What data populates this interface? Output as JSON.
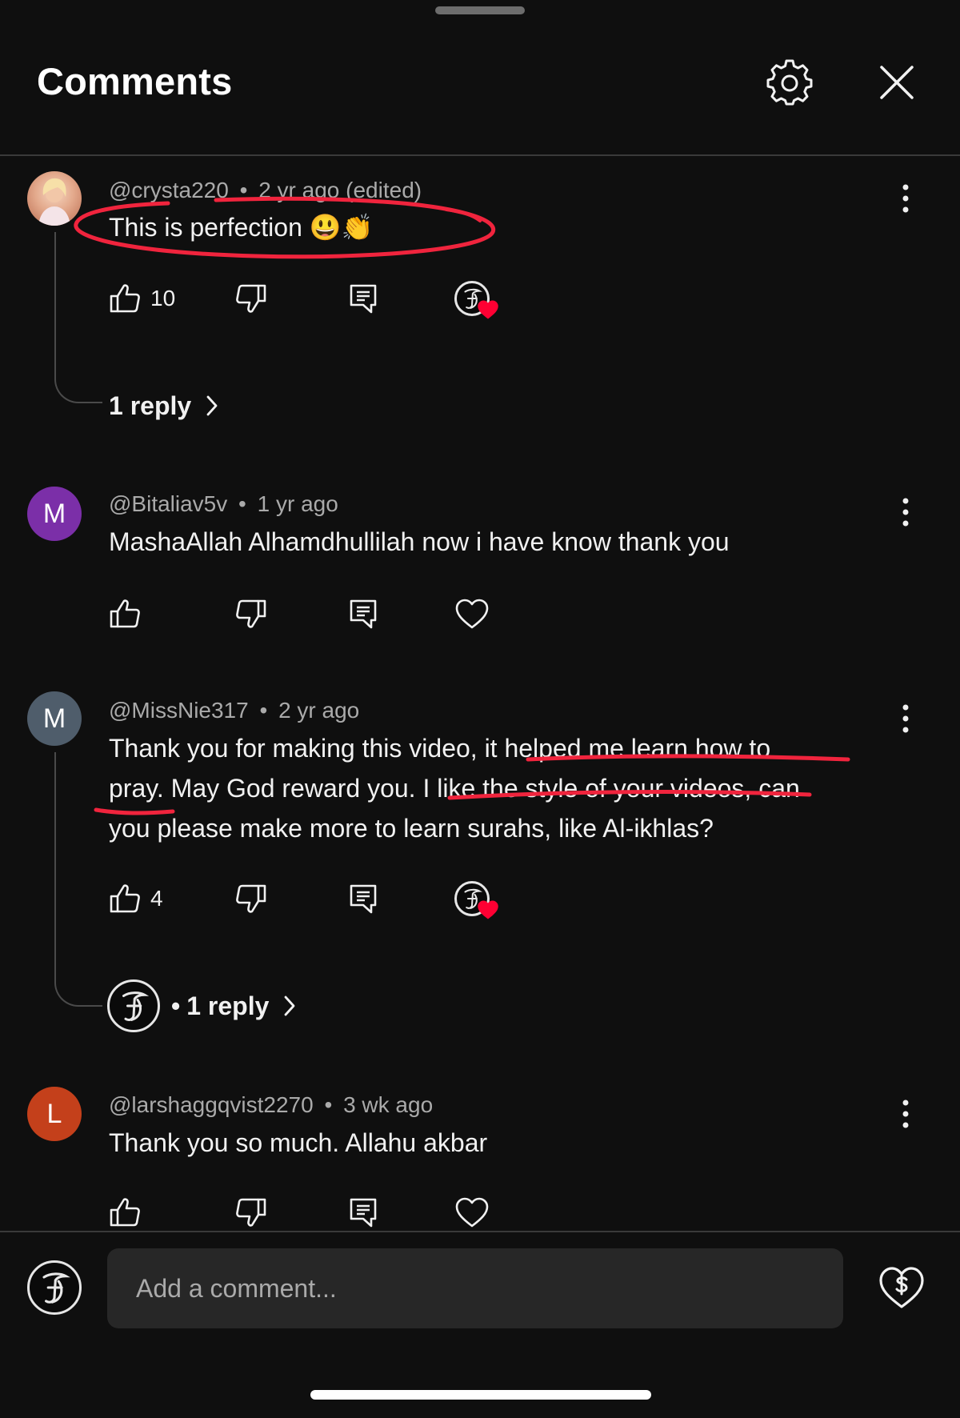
{
  "header": {
    "title": "Comments",
    "settings_icon": "gear-icon",
    "close_icon": "close-icon"
  },
  "comments": [
    {
      "handle": "@crysta220",
      "sep": "•",
      "time": "2 yr ago (edited)",
      "lines": [
        "This is perfection 😃👏"
      ],
      "likes": "10",
      "creator_hearted": true,
      "replies": {
        "label": "1 reply"
      },
      "annotation": "red-circle"
    },
    {
      "handle": "@Bitaliav5v",
      "sep": "•",
      "time": "1 yr ago",
      "avatar_letter": "M",
      "avatar_color": "#7b2fa8",
      "lines": [
        "MashaAllah Alhamdhullilah now i have know thank you"
      ],
      "likes": "",
      "creator_hearted": false
    },
    {
      "handle": "@MissNie317",
      "sep": "•",
      "time": "2 yr ago",
      "avatar_letter": "M",
      "avatar_color": "#4f5d6b",
      "line1_a": "Thank you for making this video, ",
      "line1_b": "it helped me learn how to",
      "line2_a": "pray.",
      "line2_b": " May God reward you. ",
      "line2_c": "I like the style of your videos",
      "line2_d": ", can",
      "line3": "you please make more to learn surahs, like Al-ikhlas?",
      "likes": "4",
      "creator_hearted": true,
      "replies": {
        "dot": "•",
        "label": "1 reply"
      }
    },
    {
      "handle": "@larshaggqvist2270",
      "sep": "•",
      "time": "3 wk ago",
      "avatar_letter": "L",
      "avatar_color": "#c4401b",
      "lines": [
        "Thank you so much. Allahu akbar"
      ],
      "likes": "",
      "creator_hearted": false
    }
  ],
  "composer": {
    "placeholder": "Add a comment...",
    "thanks_icon": "heart-dollar-icon"
  },
  "colors": {
    "background": "#0f0f0f",
    "annotation_red": "#f0243d",
    "heart_red": "#ff0033"
  }
}
